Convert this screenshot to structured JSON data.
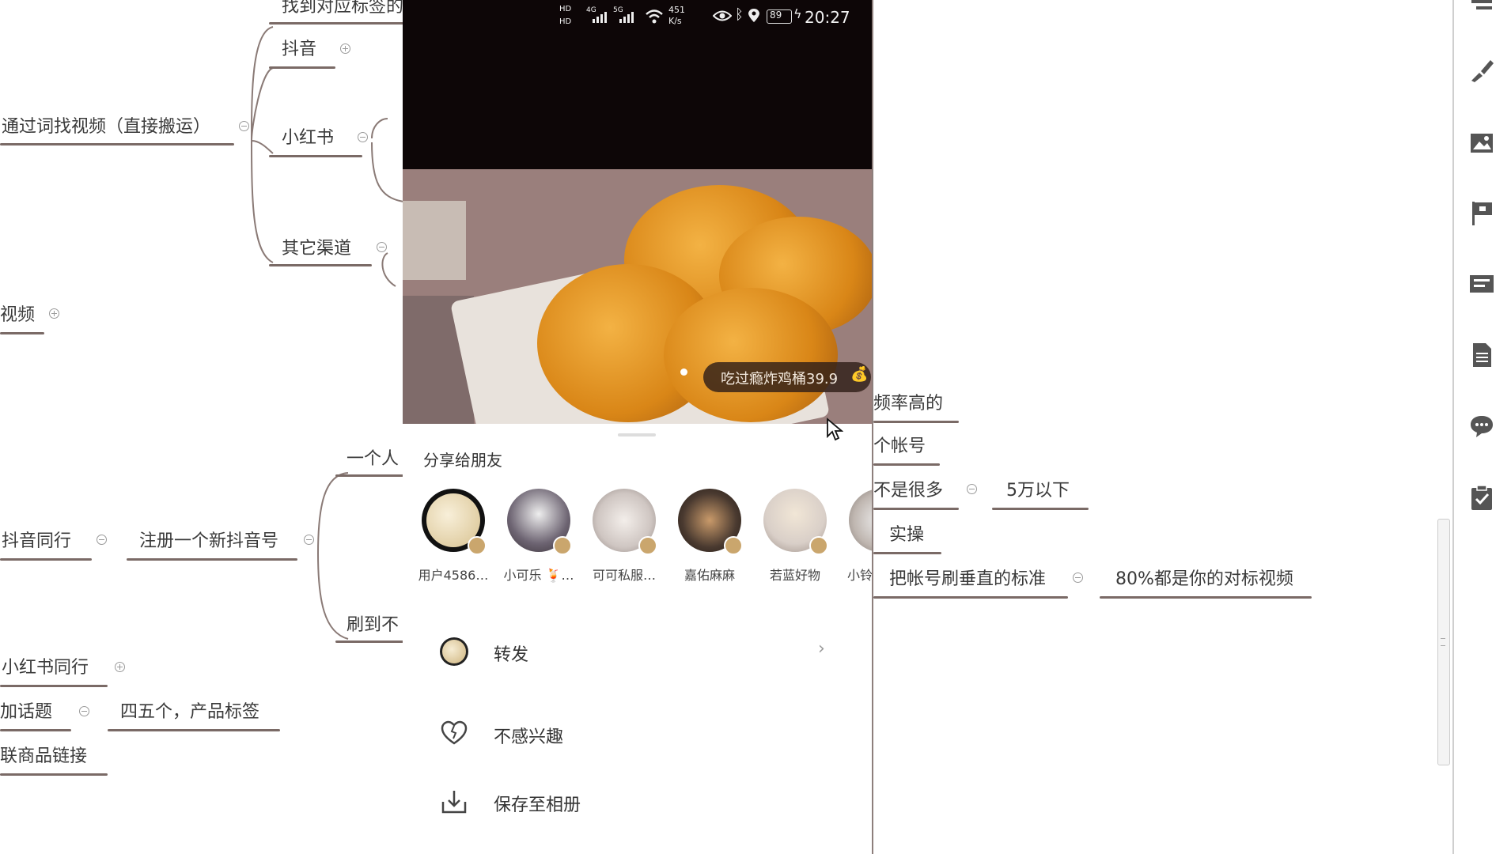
{
  "mindmap": {
    "top_cut": "找到对应标签的",
    "douyin": "抖音",
    "search_videos": "通过词找视频（直接搬运）",
    "xiaohongshu": "小红书",
    "other_channels": "其它渠道",
    "video_cut": "视频",
    "one_person": "一个人",
    "douyin_peers": "抖音同行",
    "register_new": "注册一个新抖音号",
    "scroll_to": "刷到不",
    "xhs_peers": "小红书同行",
    "add_topics": "加话题",
    "topics_detail": "四五个，产品标签",
    "link_goods": "联商品链接",
    "high_freq": "频率高的",
    "accounts": "个帐号",
    "not_many": "不是很多",
    "under_50k": "5万以下",
    "practice": "实操",
    "vertical_standard": "把帐号刷垂直的标准",
    "eighty_percent": "80%都是你的对标视频"
  },
  "phone": {
    "status": {
      "hd1": "HD",
      "hd2": "HD",
      "net1": "4G",
      "net2": "5G",
      "speed": "451",
      "speed_unit": "K/s",
      "battery": "89",
      "time": "20:27"
    },
    "video_tag": "吃过瘾炸鸡桶39.9",
    "share_title": "分享给朋友",
    "friends": [
      {
        "name": "用户4586…",
        "color": "#e9dcc0"
      },
      {
        "name": "小可乐 🍹…",
        "color": "#6d6472"
      },
      {
        "name": "可可私服…",
        "color": "#cfc6c2"
      },
      {
        "name": "嘉佑麻麻",
        "color": "#4a3a30"
      },
      {
        "name": "若蓝好物",
        "color": "#d9cfc8"
      },
      {
        "name": "小铃",
        "color": "#bfb6b0"
      }
    ],
    "actions": {
      "forward": "转发",
      "not_interested": "不感兴趣",
      "save_album": "保存至相册"
    },
    "icons": {
      "forward": "forward-avatar-icon",
      "not_interested": "heart-broken-icon",
      "save_album": "download-icon",
      "chevron": "chevron-right-icon"
    }
  },
  "toolbar": {
    "icons": [
      "outline-icon",
      "brush-icon",
      "image-icon",
      "flag-icon",
      "text-box-icon",
      "document-icon",
      "comment-icon",
      "clipboard-check-icon"
    ]
  }
}
